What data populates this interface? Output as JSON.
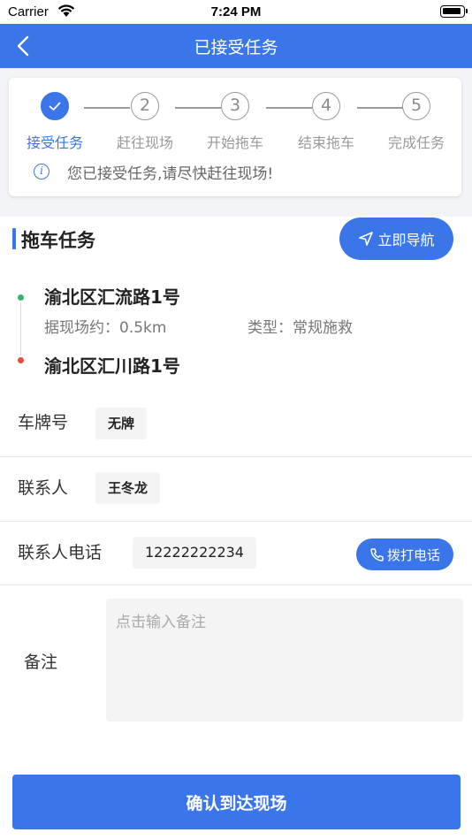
{
  "status_bar": {
    "carrier": "Carrier",
    "time": "7:24 PM"
  },
  "nav": {
    "title": "已接受任务"
  },
  "steps": [
    {
      "number": "",
      "label": "接受任务",
      "active": true
    },
    {
      "number": "2",
      "label": "赶往现场",
      "active": false
    },
    {
      "number": "3",
      "label": "开始拖车",
      "active": false
    },
    {
      "number": "4",
      "label": "结束拖车",
      "active": false
    },
    {
      "number": "5",
      "label": "完成任务",
      "active": false
    }
  ],
  "notice": {
    "text": "您已接受任务,请尽快赶往现场!"
  },
  "task": {
    "section_title": "拖车任务",
    "navigate_label": "立即导航",
    "start_address": "渝北区汇流路1号",
    "distance": "据现场约：0.5km",
    "type": "类型：常规施救",
    "end_address": "渝北区汇川路1号"
  },
  "form": {
    "plate_label": "车牌号",
    "plate_value": "无牌",
    "contact_label": "联系人",
    "contact_value": "王冬龙",
    "phone_label": "联系人电话",
    "phone_value": "12222222234",
    "call_label": "拨打电话",
    "remark_label": "备注",
    "remark_placeholder": "点击输入备注"
  },
  "confirm_label": "确认到达现场",
  "colors": {
    "accent": "#3a76ea",
    "start_dot": "#36b36b",
    "end_dot": "#e64b3c"
  }
}
